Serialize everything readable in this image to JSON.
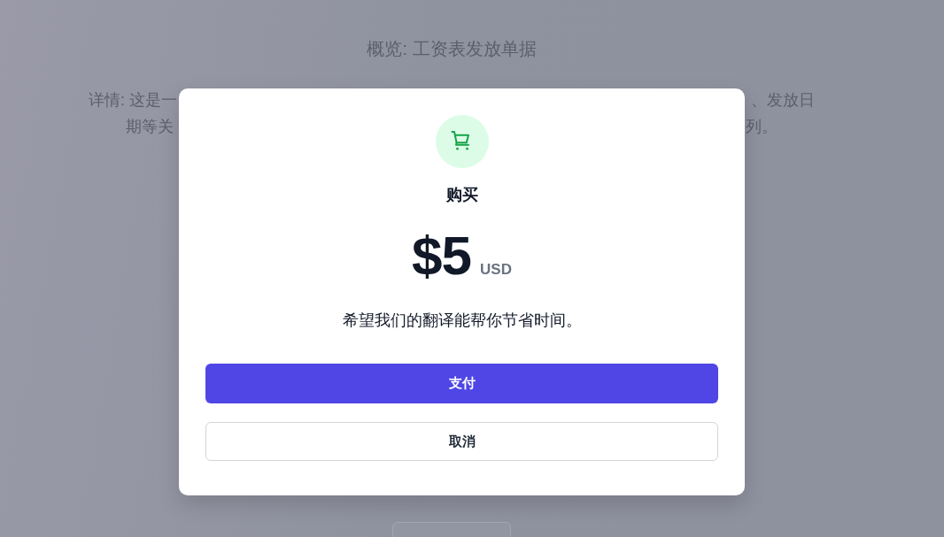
{
  "background": {
    "overview": "概览: 工资表发放单据",
    "detail_lines": [
      {
        "left": "详情: 这是一",
        "right": "、发放日"
      },
      {
        "left": "期等关",
        "right": "列。"
      }
    ]
  },
  "dialog": {
    "title": "购买",
    "price": "$5",
    "currency": "USD",
    "message": "希望我们的翻译能帮你节省时间。",
    "buttons": [
      {
        "label": "支付",
        "kind": "primary"
      },
      {
        "label": "取消",
        "kind": "secondary"
      }
    ]
  }
}
